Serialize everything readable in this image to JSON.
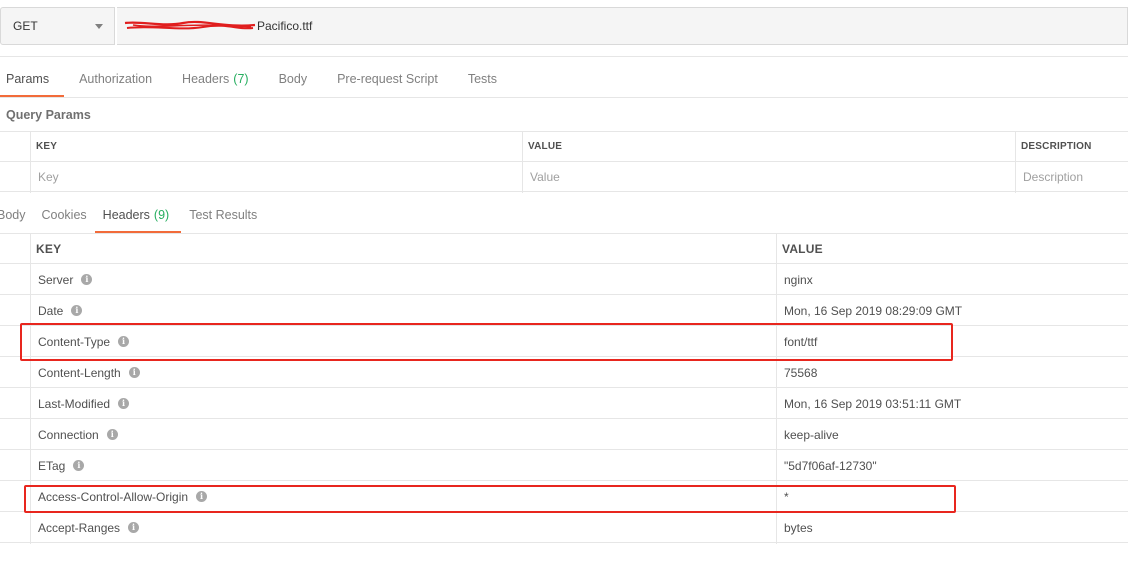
{
  "request": {
    "method": "GET",
    "url_suffix": "Pacifico.ttf"
  },
  "request_tabs": [
    {
      "label": "Params",
      "count": ""
    },
    {
      "label": "Authorization",
      "count": ""
    },
    {
      "label": "Headers",
      "count": "(7)"
    },
    {
      "label": "Body",
      "count": ""
    },
    {
      "label": "Pre-request Script",
      "count": ""
    },
    {
      "label": "Tests",
      "count": ""
    }
  ],
  "query_params": {
    "title": "Query Params",
    "columns": {
      "key": "KEY",
      "value": "VALUE",
      "description": "DESCRIPTION"
    },
    "placeholders": {
      "key": "Key",
      "value": "Value",
      "description": "Description"
    }
  },
  "response_tabs": [
    {
      "label": "Body",
      "count": ""
    },
    {
      "label": "Cookies",
      "count": ""
    },
    {
      "label": "Headers",
      "count": "(9)"
    },
    {
      "label": "Test Results",
      "count": ""
    }
  ],
  "response_headers": {
    "columns": {
      "key": "KEY",
      "value": "VALUE"
    },
    "rows": [
      {
        "key": "Server",
        "value": "nginx"
      },
      {
        "key": "Date",
        "value": "Mon, 16 Sep 2019 08:29:09 GMT"
      },
      {
        "key": "Content-Type",
        "value": "font/ttf"
      },
      {
        "key": "Content-Length",
        "value": "75568"
      },
      {
        "key": "Last-Modified",
        "value": "Mon, 16 Sep 2019 03:51:11 GMT"
      },
      {
        "key": "Connection",
        "value": "keep-alive"
      },
      {
        "key": "ETag",
        "value": "\"5d7f06af-12730\""
      },
      {
        "key": "Access-Control-Allow-Origin",
        "value": "*"
      },
      {
        "key": "Accept-Ranges",
        "value": "bytes"
      }
    ]
  },
  "icons": {
    "info": "info-icon",
    "dropdown": "chevron-down-icon"
  },
  "colors": {
    "accent": "#f26b3a",
    "count": "#27ae60",
    "highlight": "#e8261e"
  }
}
